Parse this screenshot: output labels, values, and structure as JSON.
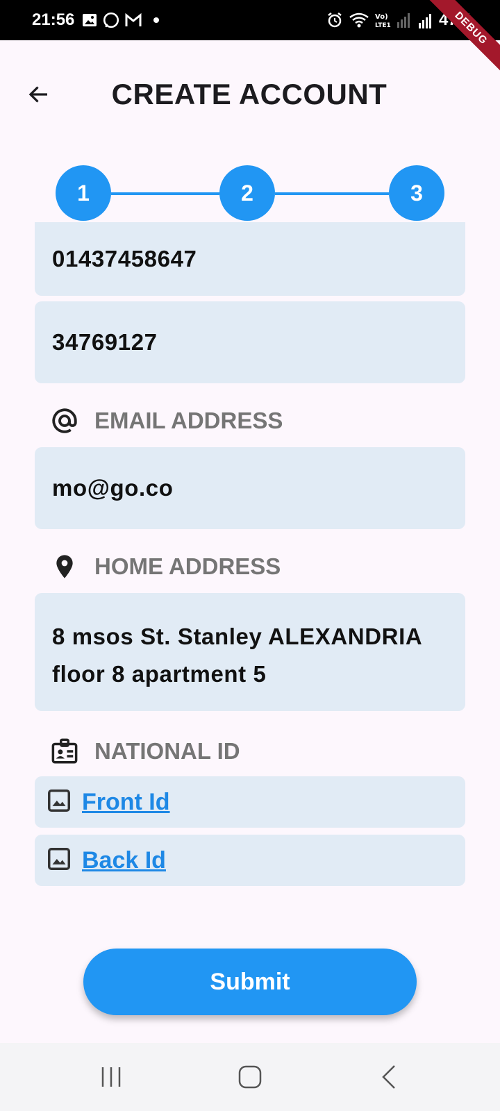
{
  "status_bar": {
    "time": "21:56",
    "battery": "47%"
  },
  "debug_banner": "DEBUG",
  "header": {
    "title": "CREATE ACCOUNT",
    "back_icon": "arrow-left-icon"
  },
  "stepper": {
    "steps": [
      "1",
      "2",
      "3"
    ],
    "current_step": 3,
    "color": "#2196f3"
  },
  "fields": {
    "phone_1": "01437458647",
    "phone_2": "34769127",
    "email_label": "EMAIL ADDRESS",
    "email_value": "mo@go.co",
    "home_label": "HOME ADDRESS",
    "home_value_line1": "8 msos St. Stanley ALEXANDRIA",
    "home_value_line2": "floor 8 apartment 5",
    "national_id_label": "NATIONAL ID"
  },
  "id_links": {
    "front": "Front Id",
    "back": "Back Id"
  },
  "submit_label": "Submit",
  "colors": {
    "accent": "#2196f3",
    "field_bg": "#e1ebf5",
    "link": "#1e88e5",
    "label": "#757575"
  }
}
